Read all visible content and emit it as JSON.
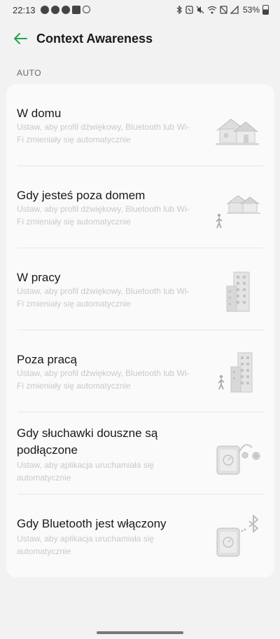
{
  "status_bar": {
    "time": "22:13",
    "battery": "53%",
    "left_icons": [
      "spotify-icon",
      "messenger-icon",
      "whatsapp-icon",
      "gallery-icon",
      "dnd-icon"
    ],
    "right_icons": [
      "bluetooth-icon",
      "nfc-icon",
      "mute-icon",
      "wifi-icon",
      "data-saver-icon",
      "signal-icon",
      "battery-icon"
    ]
  },
  "app_bar": {
    "title": "Context Awareness",
    "accent_color": "#1fa64a"
  },
  "section": {
    "header": "AUTO"
  },
  "items": [
    {
      "title": "W domu",
      "description": "Ustaw, aby profil dźwiękowy, Bluetooth lub Wi-Fi zmieniały się automatycznie",
      "illustration": "house-icon"
    },
    {
      "title": "Gdy jesteś poza domem",
      "description": "Ustaw, aby profil dźwiękowy, Bluetooth lub Wi-Fi zmieniały się automatycznie",
      "illustration": "house-walking-person-icon"
    },
    {
      "title": "W pracy",
      "description": "Ustaw, aby profil dźwiękowy, Bluetooth lub Wi-Fi zmieniały się automatycznie",
      "illustration": "office-building-icon"
    },
    {
      "title": "Poza pracą",
      "description": "Ustaw, aby profil dźwiękowy, Bluetooth lub Wi-Fi zmieniały się automatycznie",
      "illustration": "office-walking-person-icon"
    },
    {
      "title": "Gdy słuchawki douszne są podłączone",
      "description": "Ustaw, aby aplikacja uruchamiała się automatycznie",
      "illustration": "phone-earphones-icon"
    },
    {
      "title": "Gdy Bluetooth jest włączony",
      "description": "Ustaw, aby aplikacja uruchamiała się automatycznie",
      "illustration": "phone-bluetooth-icon"
    }
  ]
}
